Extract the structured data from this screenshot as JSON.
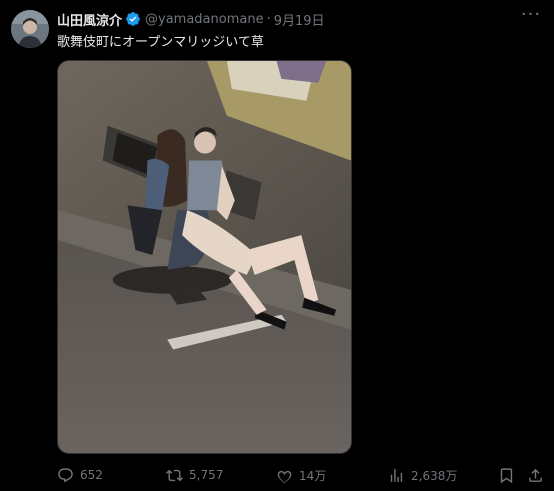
{
  "post": {
    "author_name": "山田風涼介",
    "handle": "@yamadanomane",
    "separator": "·",
    "date": "9月19日",
    "text": "歌舞伎町にオープンマリッジいて草",
    "more_label": "···"
  },
  "actions": {
    "replies": "652",
    "reposts": "5,757",
    "likes": "14万",
    "views": "2,638万"
  },
  "icons": {
    "verified": "verified-badge-icon",
    "reply": "reply-icon",
    "repost": "repost-icon",
    "like": "heart-icon",
    "views": "views-icon",
    "bookmark": "bookmark-icon",
    "share": "share-icon"
  },
  "colors": {
    "background": "#000000",
    "text": "#e7e9ea",
    "muted": "#71767b",
    "verified": "#1d9bf0"
  }
}
